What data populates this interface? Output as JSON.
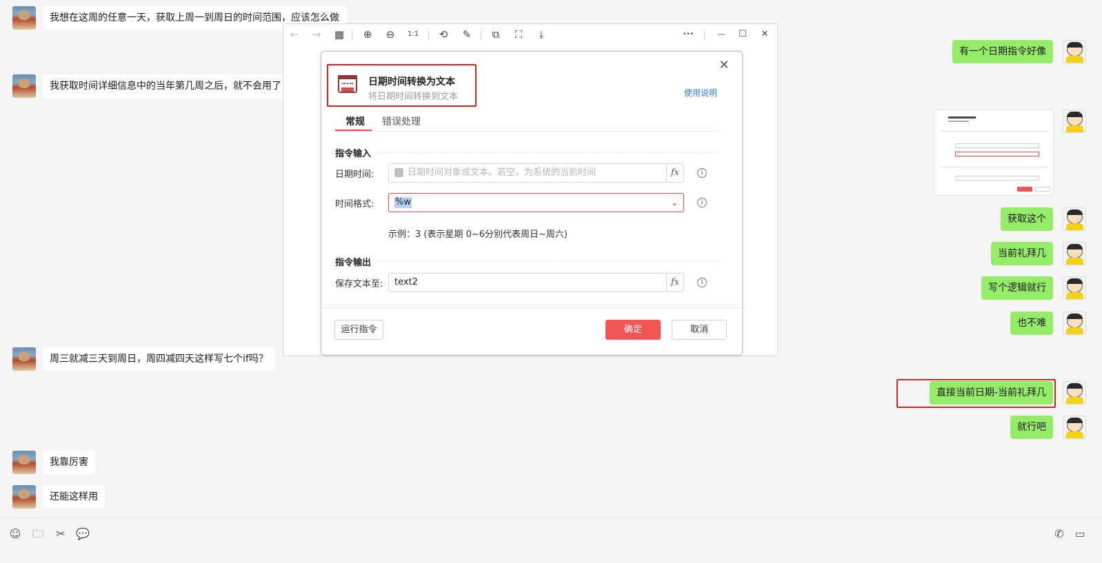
{
  "chat": {
    "messages_left": [
      {
        "text": "我想在这周的任意一天，获取上周一到周日的时间范围，应该怎么做"
      },
      {
        "text": "我获取时间详细信息中的当年第几周之后，就不会用了"
      },
      {
        "text": "周三就减三天到周日，周四减四天这样写七个if吗？"
      },
      {
        "text": "我靠厉害"
      },
      {
        "text": "还能这样用"
      }
    ],
    "messages_right": [
      {
        "text": "有一个日期指令好像"
      },
      {
        "text": "获取这个"
      },
      {
        "text": "当前礼拜几"
      },
      {
        "text": "写个逻辑就行"
      },
      {
        "text": "也不难"
      },
      {
        "text": "直接当前日期-当前礼拜几"
      },
      {
        "text": "就行吧"
      }
    ]
  },
  "viewer": {
    "toolbar_icons": [
      "back-icon",
      "forward-icon",
      "grid-icon",
      "zoom-in-icon",
      "zoom-out-icon",
      "actual-size-icon",
      "rotate-icon",
      "edit-icon",
      "extract-icon",
      "scan-icon",
      "download-icon",
      "more-icon",
      "minimize-icon",
      "maximize-icon",
      "close-icon"
    ],
    "toolbar_glyphs": {
      "back": "←",
      "forward": "→",
      "grid": "▦",
      "zoom_in": "⊕",
      "zoom_out": "⊖",
      "actual": "1:1",
      "rotate": "⟲",
      "edit": "✎",
      "extract": "⧉",
      "scan": "⛶",
      "download": "⤓",
      "more": "•••",
      "minimize": "—",
      "maximize": "☐",
      "close": "✕"
    }
  },
  "dialog": {
    "title": "日期时间转换为文本",
    "subtitle": "将日期时间转换到文本",
    "help_link": "使用说明",
    "close_glyph": "✕",
    "tabs": [
      {
        "label": "常规",
        "active": true
      },
      {
        "label": "错误处理",
        "active": false
      }
    ],
    "input_section": "指令输入",
    "fields": {
      "datetime": {
        "label": "日期时间:",
        "placeholder": "日期时间对象或文本。若空，为系统的当前时间",
        "fx": "fx"
      },
      "format": {
        "label": "时间格式:",
        "value": "%w",
        "chevron": "⌄"
      },
      "example": "示例：3 (表示星期 0~6分别代表周日~周六)"
    },
    "output_section": "指令输出",
    "output": {
      "label": "保存文本至:",
      "value": "text2",
      "fx": "fx"
    },
    "info_glyph": "i",
    "buttons": {
      "run": "运行指令",
      "ok": "确定",
      "cancel": "取消"
    }
  },
  "inputbar": {
    "glyphs": {
      "emoji": "☺",
      "folder": "🗀",
      "scissors": "✂",
      "chat": "💬",
      "phone": "✆",
      "video": "▭"
    }
  },
  "colors": {
    "highlight_box": "#e21d1d",
    "accent": "#f25555",
    "bubble_right": "#95ec69",
    "link": "#2f7de1"
  }
}
